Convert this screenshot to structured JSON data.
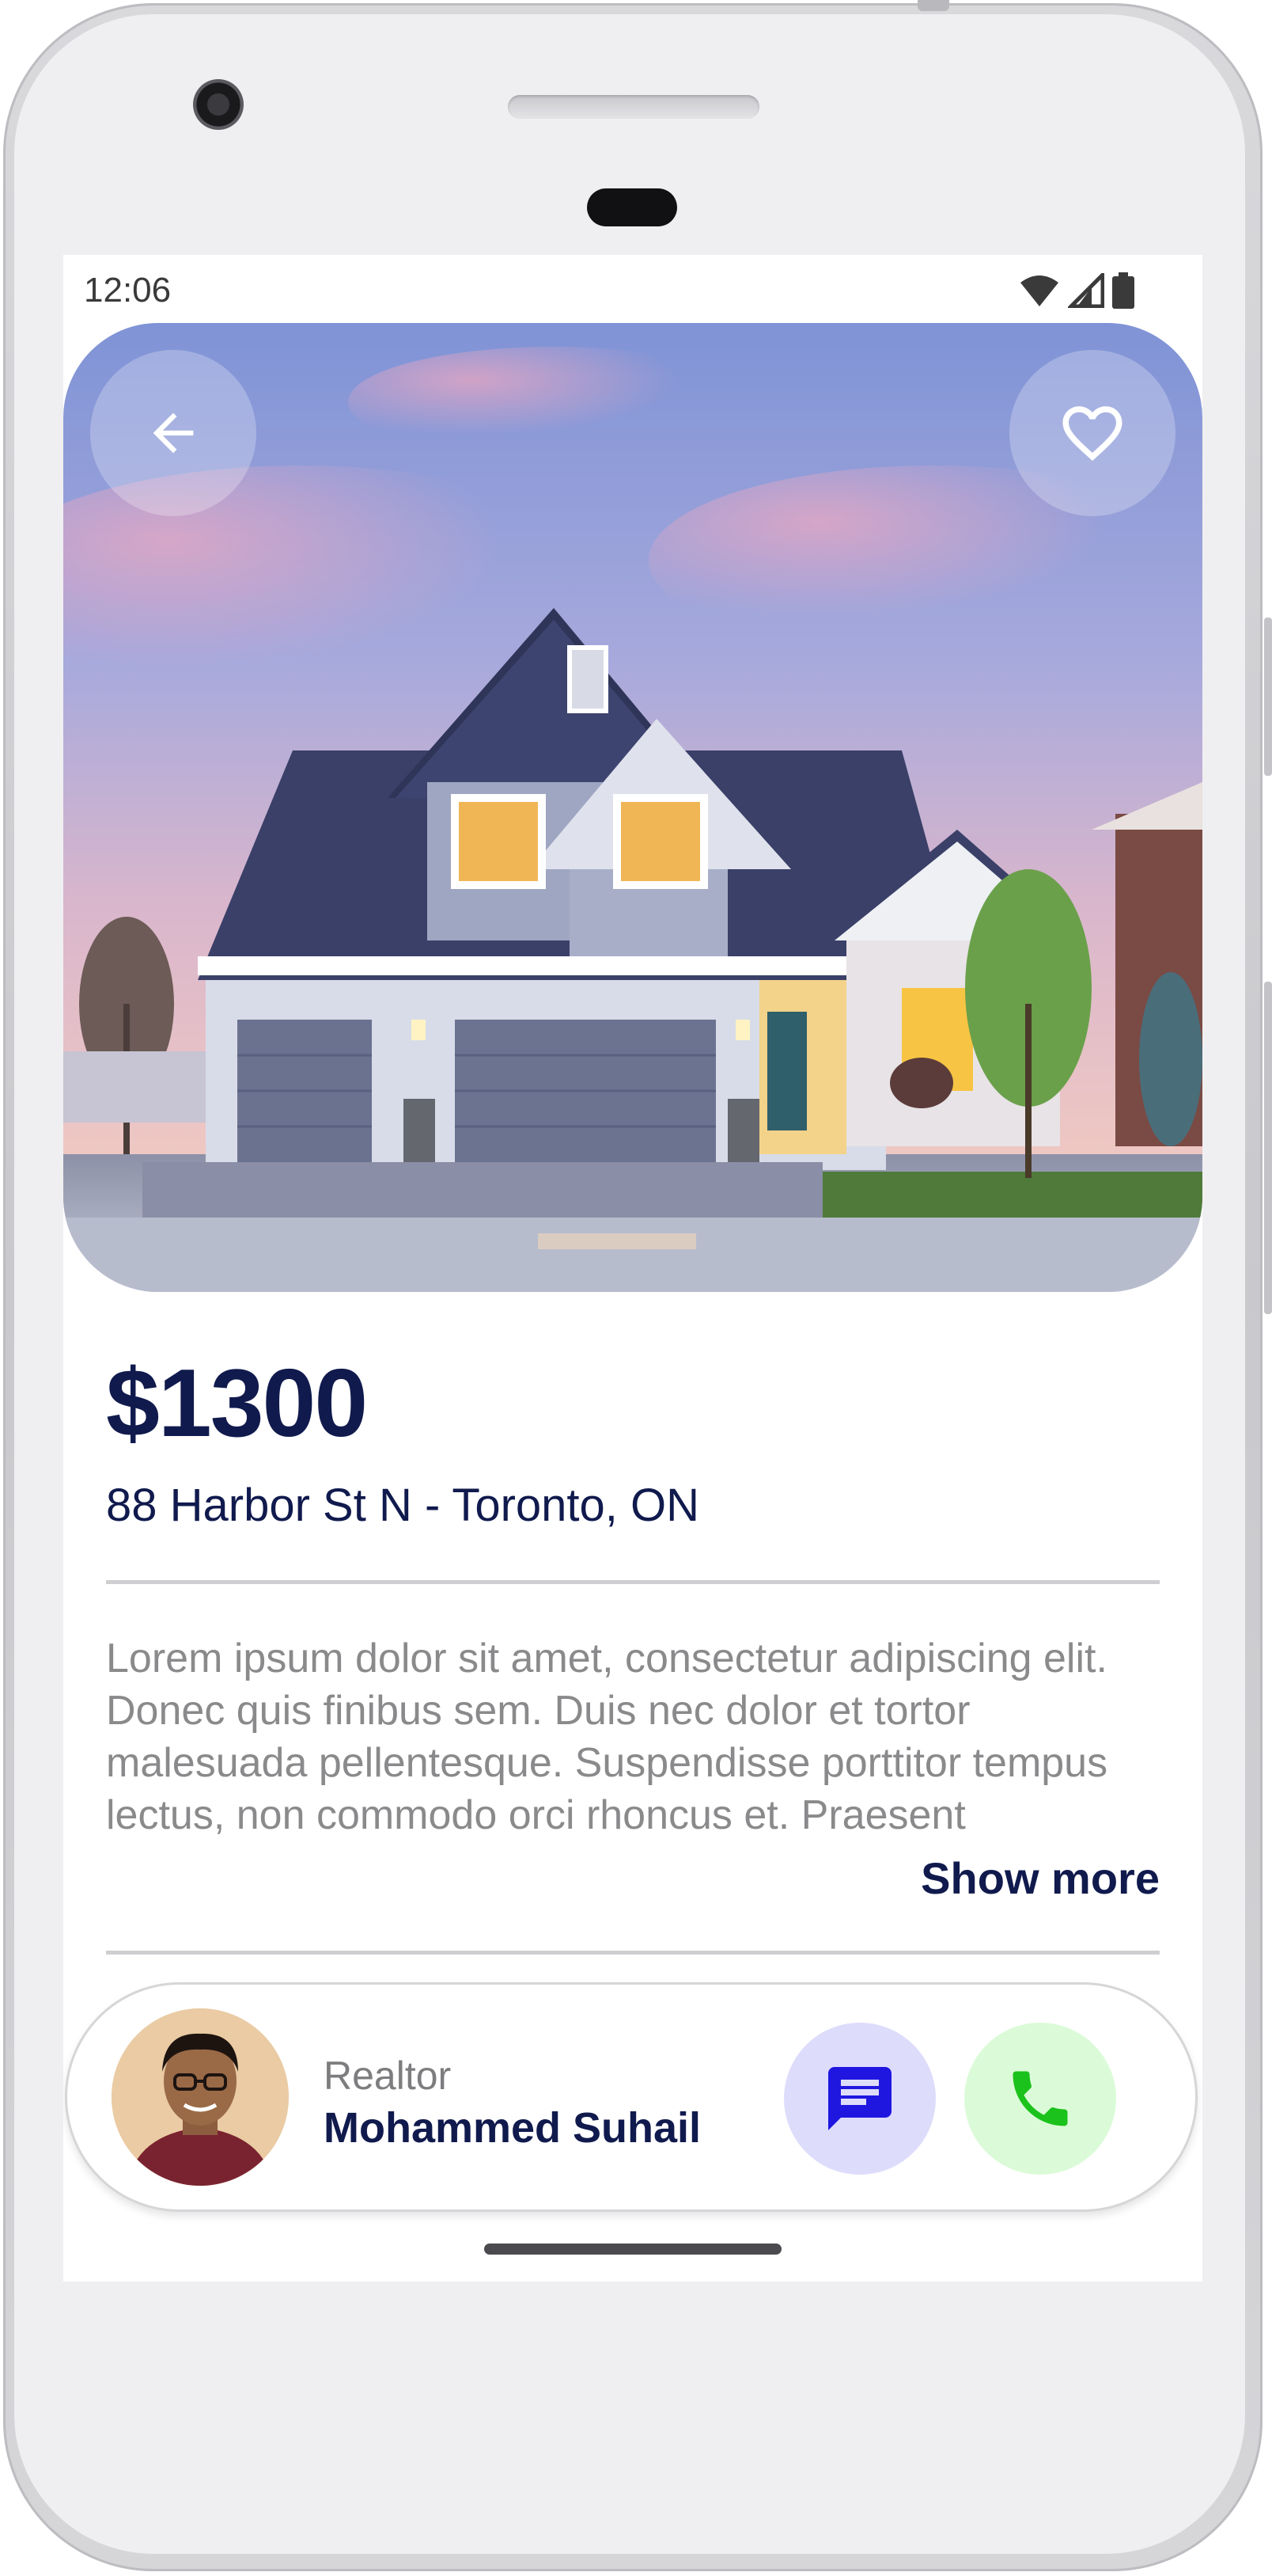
{
  "status_bar": {
    "time": "12:06",
    "icons": [
      "wifi-icon",
      "signal-icon",
      "battery-icon"
    ]
  },
  "hero": {
    "image_subject": "house-photo",
    "back_icon": "arrow-left-icon",
    "favorite_icon": "heart-outline-icon"
  },
  "listing": {
    "price": "$1300",
    "address": "88 Harbor St N - Toronto, ON",
    "description": "Lorem ipsum dolor sit amet, consectetur adipiscing elit. Donec quis finibus sem. Duis nec dolor et tortor malesuada pellentesque. Suspendisse porttitor tempus lectus, non commodo orci rhoncus et. Praesent",
    "show_more_label": "Show more"
  },
  "realtor": {
    "role": "Realtor",
    "name": "Mohammed Suhail",
    "message_icon": "message-icon",
    "call_icon": "phone-icon"
  },
  "colors": {
    "primary_text": "#101a4d",
    "muted_text": "#8a8a8c",
    "message_bg": "#dedcfb",
    "message_icon": "#1f17e0",
    "call_bg": "#dbfbd8",
    "call_icon": "#1bc21b"
  }
}
